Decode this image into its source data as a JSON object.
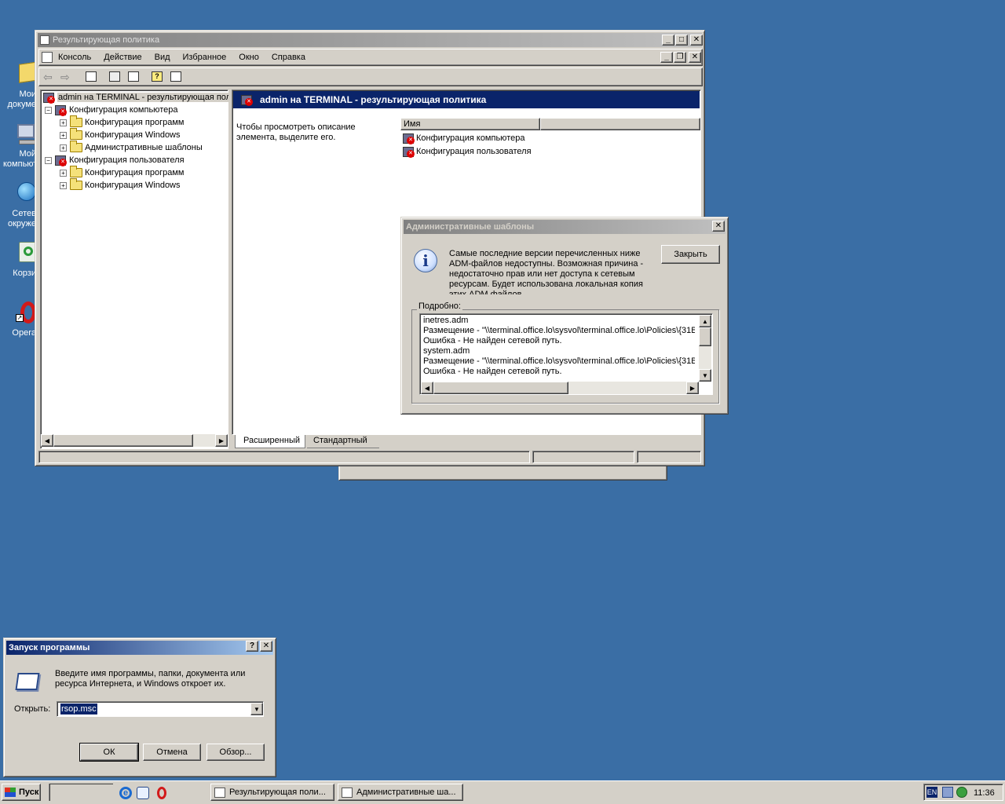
{
  "desktop": {
    "icons": [
      {
        "label": "Мои\nдокуме",
        "name": "my-documents"
      },
      {
        "label": "Мой\nкомпьют",
        "name": "my-computer"
      },
      {
        "label": "Сетев\nокруже",
        "name": "network-places"
      },
      {
        "label": "Корзи",
        "name": "recycle-bin"
      },
      {
        "label": "Opera",
        "name": "opera"
      }
    ]
  },
  "mmc": {
    "title": "Результирующая политика",
    "menu": [
      "Консоль",
      "Действие",
      "Вид",
      "Избранное",
      "Окно",
      "Справка"
    ],
    "tree": {
      "root": "admin на TERMINAL - результирующая пол",
      "computer": "Конфигурация компьютера",
      "computer_children": [
        "Конфигурация программ",
        "Конфигурация Windows",
        "Административные шаблоны"
      ],
      "user": "Конфигурация пользователя",
      "user_children": [
        "Конфигурация программ",
        "Конфигурация Windows"
      ]
    },
    "pane_header": "admin на TERMINAL - результирующая политика",
    "description": "Чтобы просмотреть описание элемента, выделите его.",
    "column_name": "Имя",
    "list": [
      "Конфигурация компьютера",
      "Конфигурация пользователя"
    ],
    "tabs": [
      "Расширенный",
      "Стандартный"
    ]
  },
  "adm_dialog": {
    "title": "Административные шаблоны",
    "message": "Самые последние версии перечисленных ниже ADM-файлов недоступны. Возможная причина - недостаточно прав или нет доступа к сетевым ресурсам. Будет использована локальная копия этих ADM файлов.",
    "close_label": "Закрыть",
    "details_label": "Подробно:",
    "details": [
      "inetres.adm",
      "Размещение - \"\\\\terminal.office.lo\\sysvol\\terminal.office.lo\\Policies\\{31B",
      "Ошибка - Не найден сетевой путь.",
      "system.adm",
      "Размещение - \"\\\\terminal.office.lo\\sysvol\\terminal.office.lo\\Policies\\{31B",
      "Ошибка - Не найден сетевой путь."
    ]
  },
  "run_dialog": {
    "title": "Запуск программы",
    "help": "?",
    "prompt": "Введите имя программы, папки, документа или ресурса Интернета, и Windows откроет их.",
    "open_label": "Открыть:",
    "value": "rsop.msc",
    "ok": "ОК",
    "cancel": "Отмена",
    "browse": "Обзор..."
  },
  "taskbar": {
    "start": "Пуск",
    "tasks": [
      "Результирующая поли...",
      "Административные ша..."
    ],
    "lang": "EN",
    "clock": "11:36"
  },
  "colors": {
    "desktop": "#3a6ea5",
    "title_active": "#0a246a",
    "title_inactive": "#808080",
    "face": "#d4d0c8"
  }
}
